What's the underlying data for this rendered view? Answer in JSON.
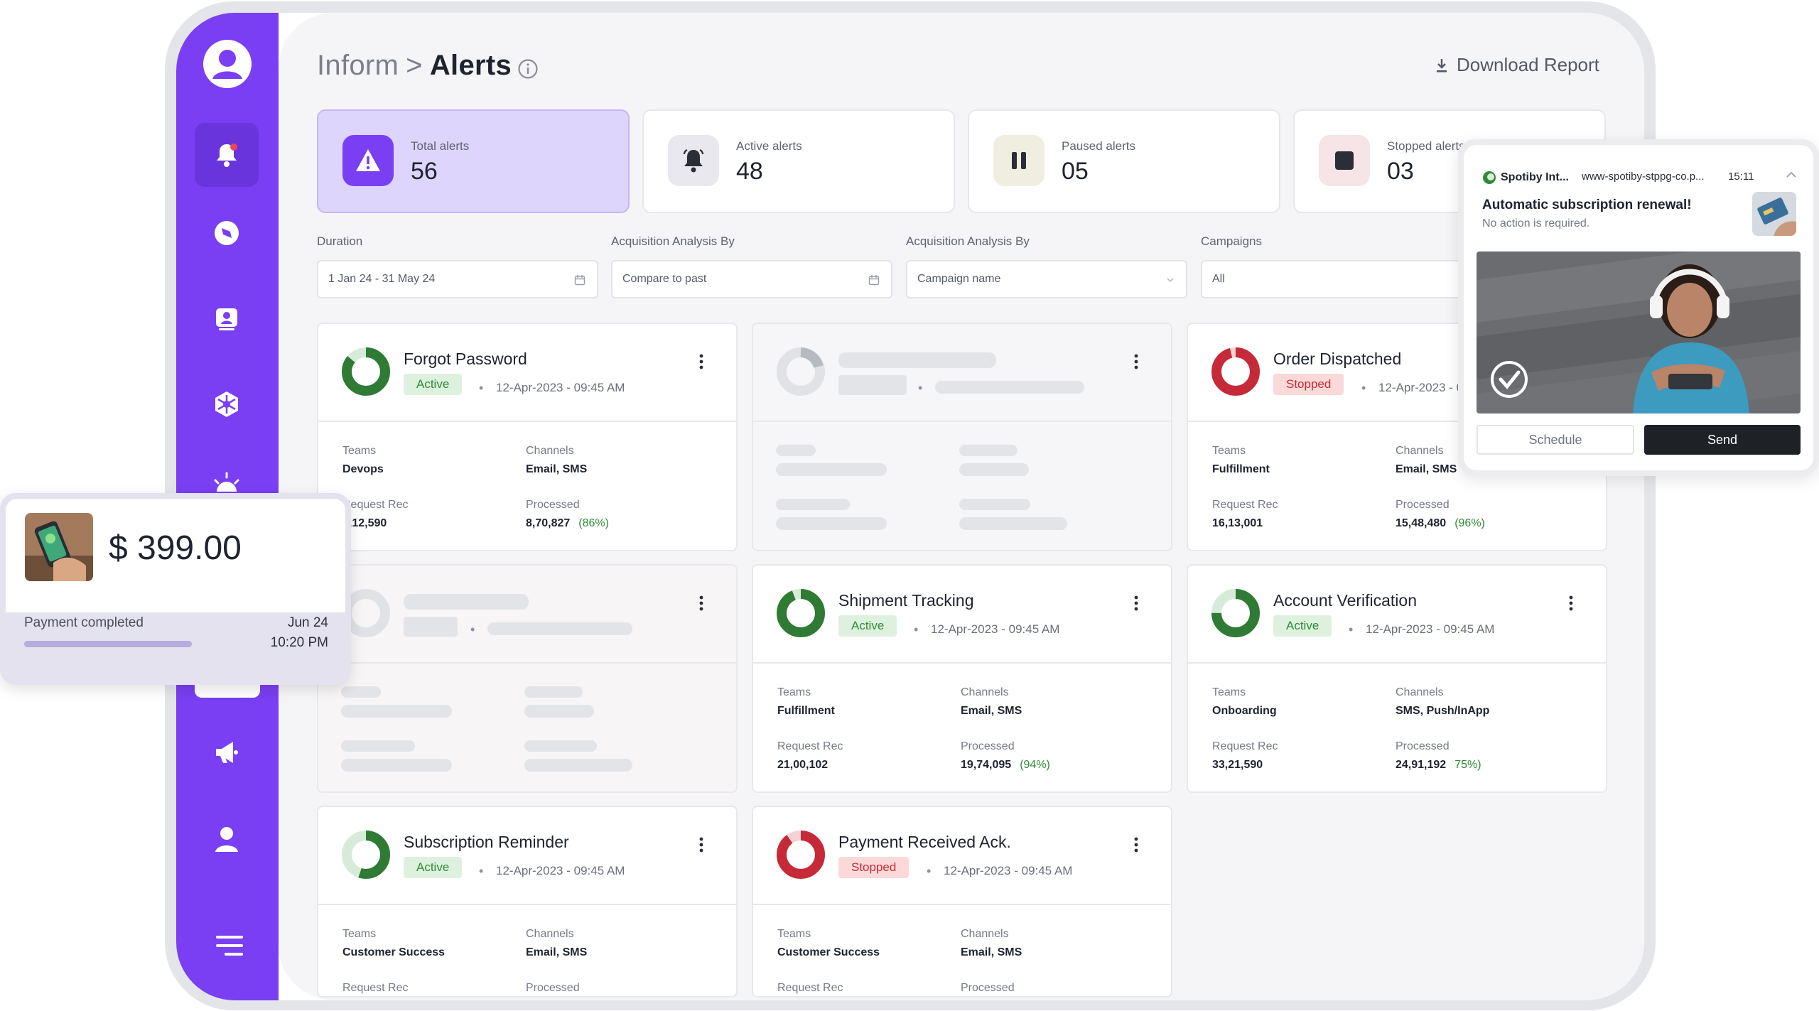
{
  "header": {
    "crumb": "Inform",
    "separator": ">",
    "current": "Alerts",
    "download_label": "Download Report"
  },
  "stats": [
    {
      "label": "Total alerts",
      "value": "56",
      "icon": "warning-icon",
      "color": "#7a3ff2"
    },
    {
      "label": "Active alerts",
      "value": "48",
      "icon": "bell-icon"
    },
    {
      "label": "Paused alerts",
      "value": "05",
      "icon": "pause-icon"
    },
    {
      "label": "Stopped alerts",
      "value": "03",
      "icon": "stop-icon"
    }
  ],
  "filters": [
    {
      "label": "Duration",
      "value": "1 Jan 24 - 31 May 24",
      "icon": "calendar-icon"
    },
    {
      "label": "Acquisition Analysis By",
      "value": "Compare to past",
      "icon": "calendar-icon"
    },
    {
      "label": "Acquisition Analysis By",
      "value": "Campaign name",
      "icon": "chevron-down-icon"
    },
    {
      "label": "Campaigns",
      "value": "All"
    }
  ],
  "card_labels": {
    "teams": "Teams",
    "channels": "Channels",
    "request_rec": "Request Rec",
    "processed": "Processed",
    "dot": "•"
  },
  "cards": [
    {
      "name": "Forgot Password",
      "status": "Active",
      "date": "12-Apr-2023 - 09:45 AM",
      "team": "Devops",
      "channels": "Email, SMS",
      "request": "1,12,590",
      "processed": "8,70,827",
      "pct": "(86%)",
      "progress": 0.86
    },
    {
      "name": "Order Dispatched",
      "status": "Stopped",
      "date": "12-Apr-2023 - 09:45 AM",
      "team": "Fulfillment",
      "channels": "Email, SMS",
      "request": "16,13,001",
      "processed": "15,48,480",
      "pct": "(96%)",
      "progress": 0.96
    },
    {
      "name": "Shipment Tracking",
      "status": "Active",
      "date": "12-Apr-2023 - 09:45 AM",
      "team": "Fulfillment",
      "channels": "Email, SMS",
      "request": "21,00,102",
      "processed": "19,74,095",
      "pct": "(94%)",
      "progress": 0.94
    },
    {
      "name": "Account Verification",
      "status": "Active",
      "date": "12-Apr-2023 - 09:45 AM",
      "team": "Onboarding",
      "channels": "SMS, Push/InApp",
      "request": "33,21,590",
      "processed": "24,91,192",
      "pct": "75%)",
      "progress": 0.75
    },
    {
      "name": "Subscription Reminder",
      "status": "Active",
      "date": "12-Apr-2023 - 09:45 AM",
      "team": "Customer Success",
      "channels": "Email, SMS",
      "request": "",
      "processed": "",
      "pct": "",
      "progress": 0.55
    },
    {
      "name": "Payment Received Ack.",
      "status": "Stopped",
      "date": "12-Apr-2023 - 09:45 AM",
      "team": "Customer Success",
      "channels": "Email, SMS",
      "request": "",
      "processed": "",
      "pct": "",
      "progress": 0.9
    }
  ],
  "payment": {
    "amount": "$ 399.00",
    "status": "Payment completed",
    "date": "Jun 24",
    "time": "10:20 PM"
  },
  "notification": {
    "app": "Spotiby Int...",
    "url": "www-spotiby-stppg-co.p...",
    "time": "15:11",
    "title": "Automatic subscription renewal!",
    "subtitle": "No action is required.",
    "schedule_label": "Schedule",
    "send_label": "Send"
  },
  "colors": {
    "brand": "#7a3ff2",
    "active": "#2f8a37",
    "stopped": "#c62a38"
  }
}
